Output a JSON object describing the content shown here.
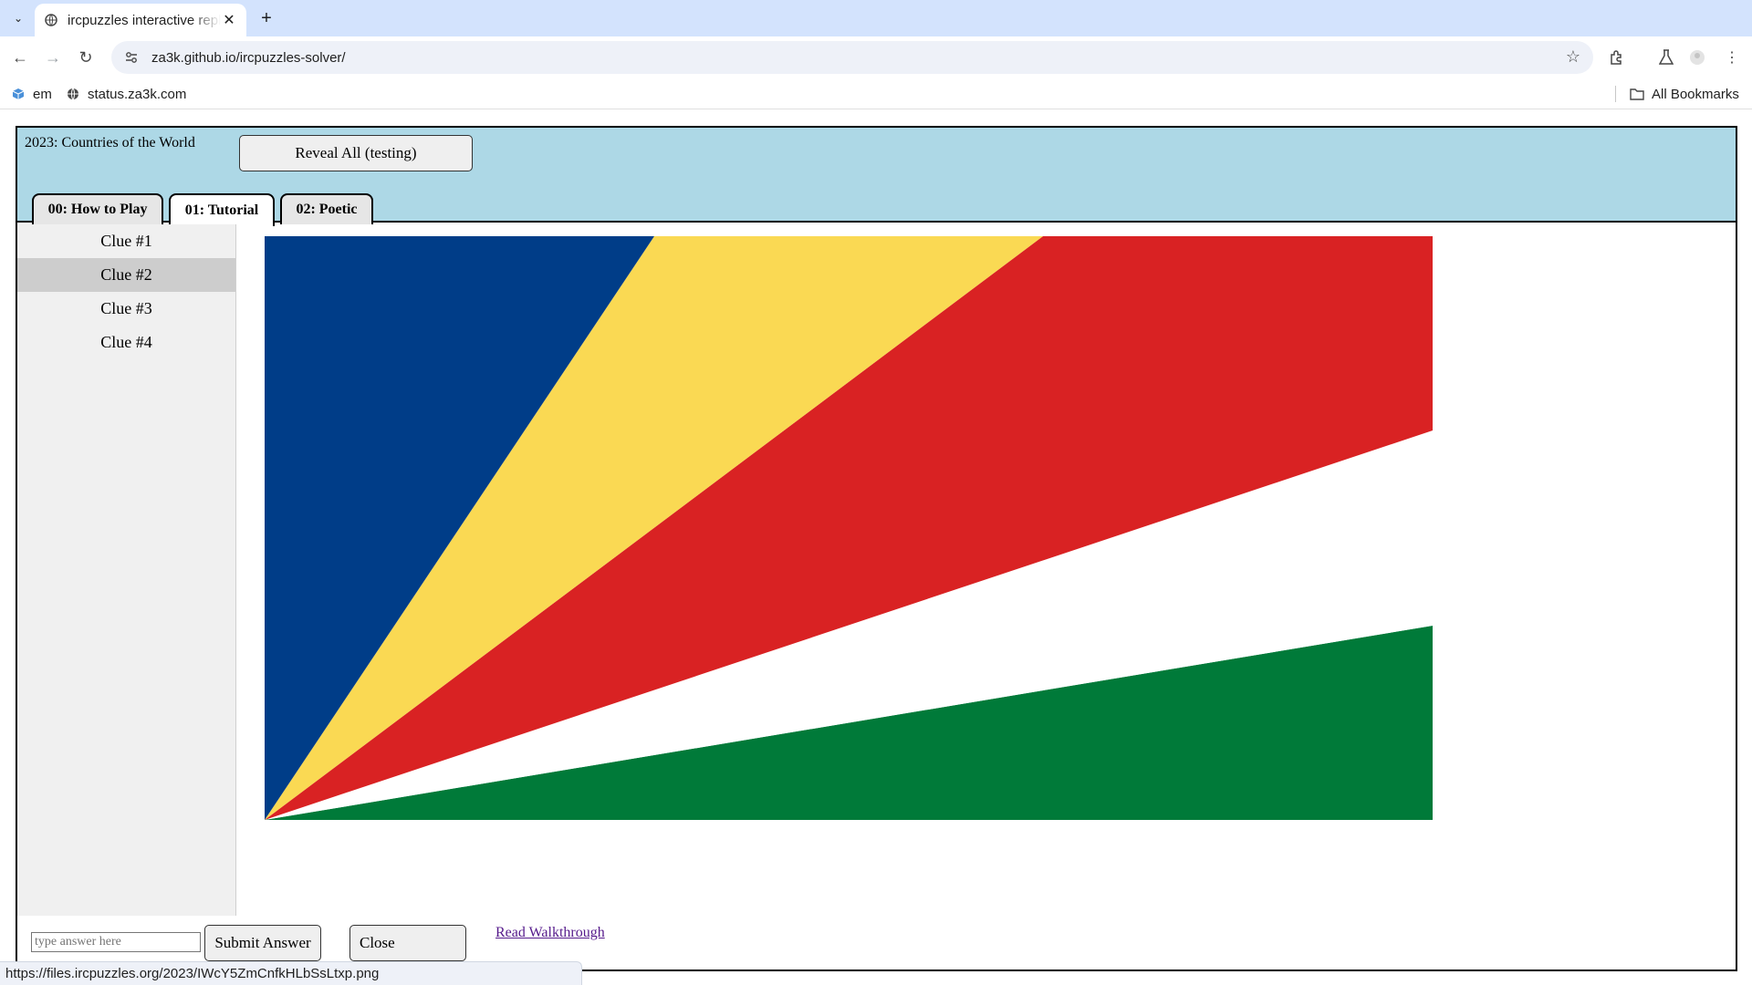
{
  "browser": {
    "tab_title": "ircpuzzles interactive replay",
    "url": "za3k.github.io/ircpuzzles-solver/",
    "bookmarks": [
      {
        "label": "em",
        "icon": "cube-icon"
      },
      {
        "label": "status.za3k.com",
        "icon": "globe-icon"
      }
    ],
    "all_bookmarks_label": "All Bookmarks",
    "status_url": "https://files.ircpuzzles.org/2023/IWcY5ZmCnfkHLbSsLtxp.png"
  },
  "app": {
    "puzzle_title": "2023: Countries of the World",
    "reveal_button": "Reveal All (testing)",
    "tabs": [
      {
        "label": "00: How to Play",
        "active": false
      },
      {
        "label": "01: Tutorial",
        "active": true
      },
      {
        "label": "02: Poetic",
        "active": false
      }
    ],
    "clues": [
      {
        "label": "Clue #1",
        "selected": false
      },
      {
        "label": "Clue #2",
        "selected": true
      },
      {
        "label": "Clue #3",
        "selected": false
      },
      {
        "label": "Clue #4",
        "selected": false
      }
    ],
    "flag_colors": {
      "blue": "#003d88",
      "yellow": "#fad953",
      "red": "#d92223",
      "white": "#ffffff",
      "green": "#007a39"
    },
    "answer_placeholder": "type answer here",
    "submit_button": "Submit Answer",
    "close_button": "Close",
    "walkthrough_link": "Read Walkthrough"
  }
}
